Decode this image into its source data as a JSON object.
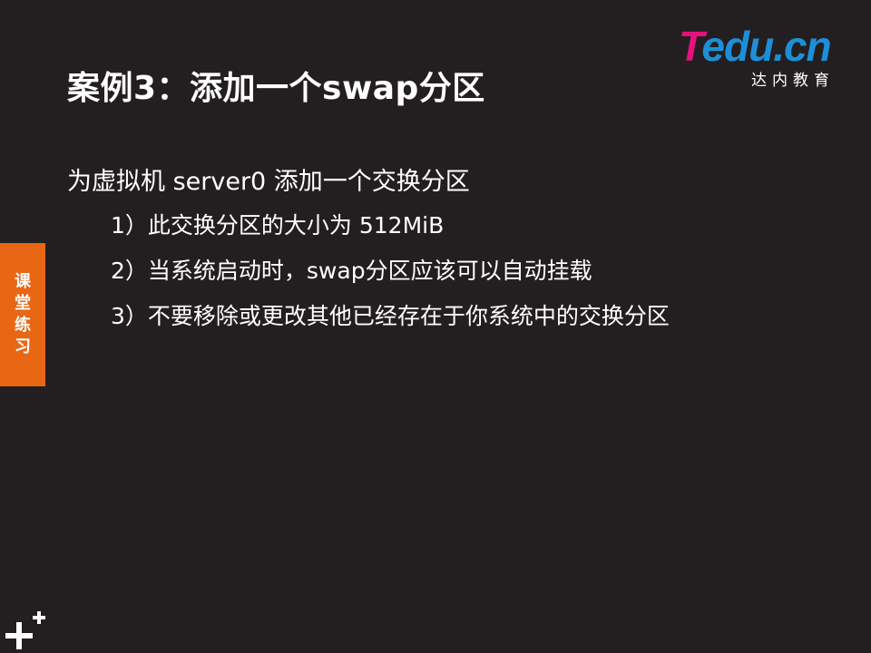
{
  "slide": {
    "title": "案例3：添加一个swap分区"
  },
  "logo": {
    "letter_t": "T",
    "word_rest": "edu",
    "dot": ".",
    "cn": "cn",
    "subtitle": "达内教育",
    "colors": {
      "pink": "#e5127d",
      "blue": "#1d8fd8"
    }
  },
  "side_tab": {
    "chars": [
      "课",
      "堂",
      "练",
      "习"
    ],
    "color": "#e86614"
  },
  "content": {
    "main": "为虚拟机 server0 添加一个交换分区",
    "items": [
      "1）此交换分区的大小为  512MiB",
      "2）当系统启动时，swap分区应该可以自动挂载",
      "3）不要移除或更改其他已经存在于你系统中的交换分区"
    ]
  },
  "footer": {
    "icon": "plus-plus-icon"
  },
  "theme": {
    "background": "#231f20",
    "text": "#ffffff"
  }
}
